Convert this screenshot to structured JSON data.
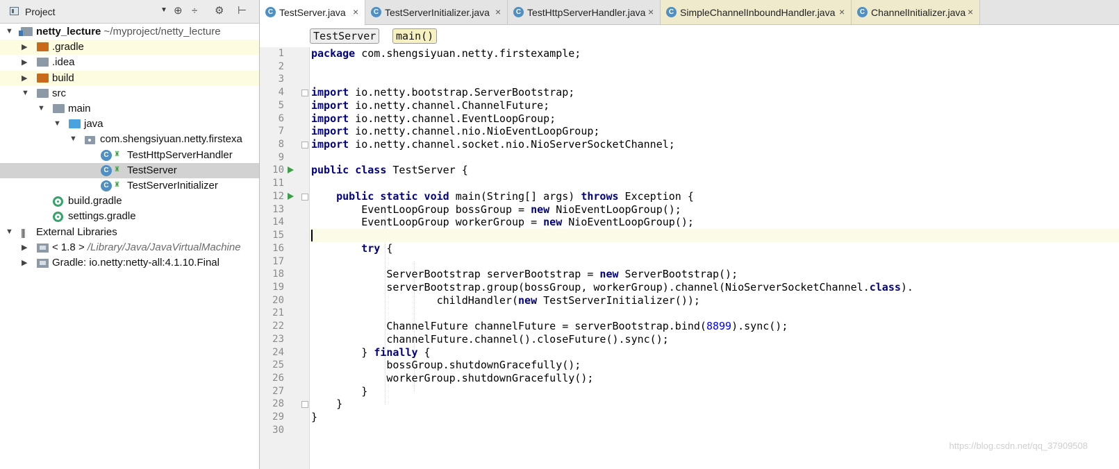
{
  "project_panel": {
    "title": "Project",
    "dropdown": "▼",
    "tools": [
      "⊕",
      "÷",
      "⚙",
      "⊢"
    ],
    "tree": [
      {
        "label": "netty_lecture",
        "extra": "~/myproject/netty_lecture",
        "depth": 0,
        "arrow": "▼",
        "icon": "module-folder-icon",
        "bold": true
      },
      {
        "label": ".gradle",
        "depth": 1,
        "arrow": "▶",
        "icon": "folder-orange-icon",
        "hl": "yellow"
      },
      {
        "label": ".idea",
        "depth": 1,
        "arrow": "▶",
        "icon": "folder-gray-icon"
      },
      {
        "label": "build",
        "depth": 1,
        "arrow": "▶",
        "icon": "folder-orange-icon",
        "hl": "yellow"
      },
      {
        "label": "src",
        "depth": 1,
        "arrow": "▼",
        "icon": "folder-gray-icon"
      },
      {
        "label": "main",
        "depth": 2,
        "arrow": "▼",
        "icon": "folder-gray-icon"
      },
      {
        "label": "java",
        "depth": 3,
        "arrow": "▼",
        "icon": "folder-blue-icon"
      },
      {
        "label": "com.shengsiyuan.netty.firstexa",
        "depth": 4,
        "arrow": "▼",
        "icon": "package-icon"
      },
      {
        "label": "TestHttpServerHandler",
        "depth": 5,
        "icon": "class-icon"
      },
      {
        "label": "TestServer",
        "depth": 5,
        "icon": "class-icon",
        "hl": "gray"
      },
      {
        "label": "TestServerInitializer",
        "depth": 5,
        "icon": "class-icon"
      },
      {
        "label": "build.gradle",
        "depth": 2,
        "icon": "gradle-icon"
      },
      {
        "label": "settings.gradle",
        "depth": 2,
        "icon": "gradle-icon"
      },
      {
        "label": "External Libraries",
        "depth": 0,
        "arrow": "▼",
        "icon": "library-icon"
      },
      {
        "label": "< 1.8 >",
        "extra": "/Library/Java/JavaVirtualMachine",
        "depth": 1,
        "arrow": "▶",
        "icon": "jdk-icon"
      },
      {
        "label": "Gradle: io.netty:netty-all:4.1.10.Final",
        "depth": 1,
        "arrow": "▶",
        "icon": "jdk-icon"
      }
    ]
  },
  "tabs": [
    {
      "label": "TestServer.java",
      "icon": "C",
      "active": true
    },
    {
      "label": "TestServerInitializer.java",
      "icon": "C"
    },
    {
      "label": "TestHttpServerHandler.java",
      "icon": "C"
    },
    {
      "label": "SimpleChannelInboundHandler.java",
      "icon": "C",
      "yellowish": true
    },
    {
      "label": "ChannelInitializer.java",
      "icon": "C",
      "yellowish": true
    }
  ],
  "tab_close": "×",
  "breadcrumb": {
    "class_name": "TestServer",
    "method_name": "main()"
  },
  "code": {
    "line_numbers": [
      "1",
      "2",
      "3",
      "4",
      "5",
      "6",
      "7",
      "8",
      "9",
      "10",
      "11",
      "12",
      "13",
      "14",
      "15",
      "16",
      "17",
      "18",
      "19",
      "20",
      "21",
      "22",
      "23",
      "24",
      "25",
      "26",
      "27",
      "28",
      "29",
      "30"
    ],
    "current_line": 15,
    "run_lines": [
      10,
      12
    ],
    "fold_lines": [
      4,
      8,
      12,
      28
    ],
    "lines": [
      [
        {
          "k": true,
          "t": "package"
        },
        {
          "t": " com.shengsiyuan.netty.firstexample;"
        }
      ],
      [],
      [],
      [
        {
          "k": true,
          "t": "import"
        },
        {
          "t": " io.netty.bootstrap.ServerBootstrap;"
        }
      ],
      [
        {
          "k": true,
          "t": "import"
        },
        {
          "t": " io.netty.channel.ChannelFuture;"
        }
      ],
      [
        {
          "k": true,
          "t": "import"
        },
        {
          "t": " io.netty.channel.EventLoopGroup;"
        }
      ],
      [
        {
          "k": true,
          "t": "import"
        },
        {
          "t": " io.netty.channel.nio.NioEventLoopGroup;"
        }
      ],
      [
        {
          "k": true,
          "t": "import"
        },
        {
          "t": " io.netty.channel.socket.nio.NioServerSocketChannel;"
        }
      ],
      [],
      [
        {
          "k": true,
          "t": "public class"
        },
        {
          "t": " TestServer {"
        }
      ],
      [],
      [
        {
          "t": "    "
        },
        {
          "k": true,
          "t": "public static void"
        },
        {
          "t": " main(String[] args) "
        },
        {
          "k": true,
          "t": "throws"
        },
        {
          "t": " Exception {"
        }
      ],
      [
        {
          "t": "        EventLoopGroup bossGroup = "
        },
        {
          "k": true,
          "t": "new"
        },
        {
          "t": " NioEventLoopGroup();"
        }
      ],
      [
        {
          "t": "        EventLoopGroup workerGroup = "
        },
        {
          "k": true,
          "t": "new"
        },
        {
          "t": " NioEventLoopGroup();"
        }
      ],
      [],
      [
        {
          "t": "        "
        },
        {
          "k": true,
          "t": "try"
        },
        {
          "t": " {"
        }
      ],
      [],
      [
        {
          "t": "            ServerBootstrap serverBootstrap = "
        },
        {
          "k": true,
          "t": "new"
        },
        {
          "t": " ServerBootstrap();"
        }
      ],
      [
        {
          "t": "            serverBootstrap.group(bossGroup, workerGroup).channel(NioServerSocketChannel."
        },
        {
          "k": true,
          "t": "class"
        },
        {
          "t": ")."
        }
      ],
      [
        {
          "t": "                    childHandler("
        },
        {
          "k": true,
          "t": "new"
        },
        {
          "t": " TestServerInitializer());"
        }
      ],
      [],
      [
        {
          "t": "            ChannelFuture channelFuture = serverBootstrap.bind("
        },
        {
          "n": true,
          "t": "8899"
        },
        {
          "t": ").sync();"
        }
      ],
      [
        {
          "t": "            channelFuture.channel().closeFuture().sync();"
        }
      ],
      [
        {
          "t": "        } "
        },
        {
          "k": true,
          "t": "finally"
        },
        {
          "t": " {"
        }
      ],
      [
        {
          "t": "            bossGroup.shutdownGracefully();"
        }
      ],
      [
        {
          "t": "            workerGroup.shutdownGracefully();"
        }
      ],
      [
        {
          "t": "        }"
        }
      ],
      [
        {
          "t": "    }"
        }
      ],
      [
        {
          "t": "}"
        }
      ],
      []
    ]
  },
  "watermark": "https://blog.csdn.net/qq_37909508"
}
